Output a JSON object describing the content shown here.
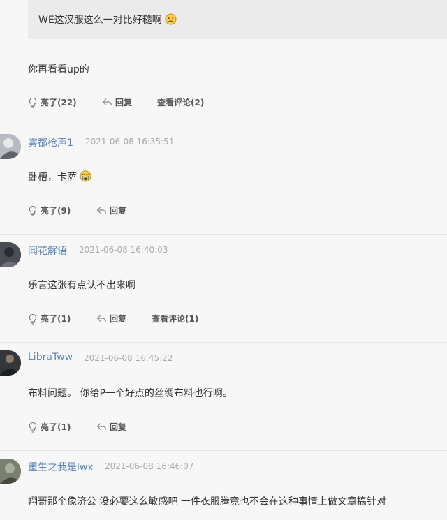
{
  "quote": {
    "text": "WE这汉服这么一对比好糙啊",
    "emoji_icon": "sad-face-icon"
  },
  "reply": {
    "text": "你再看看up的",
    "likes": "亮了(22)",
    "reply_label": "回复",
    "view_comments": "查看评论(2)"
  },
  "comments": [
    {
      "user": "雾都枪声1",
      "time": "2021-06-08 16:35:51",
      "text": "卧槽，卡萨",
      "emoji_icon": "crying-face-icon",
      "likes": "亮了(9)",
      "reply_label": "回复"
    },
    {
      "user": "闻花解语",
      "time": "2021-06-08 16:40:03",
      "text": "乐言这张有点认不出来啊",
      "likes": "亮了(1)",
      "reply_label": "回复",
      "view_comments": "查看评论(1)"
    },
    {
      "user": "LibraTww",
      "time": "2021-06-08 16:45:22",
      "text": "布料问题。 你给P一个好点的丝绸布料也行啊。",
      "likes": "亮了(1)",
      "reply_label": "回复"
    },
    {
      "user": "重生之我是lwx",
      "time": "2021-06-08 16:46:07",
      "text": "翔哥那个像济公 没必要这么敏感吧 一件衣服腾竟也不会在这种事情上做文章搞针对"
    }
  ],
  "colors": {
    "username": "#5b86b8",
    "timestamp": "#aaaaaa",
    "background": "#f7f7f7",
    "quote_bg": "#ebebeb"
  }
}
